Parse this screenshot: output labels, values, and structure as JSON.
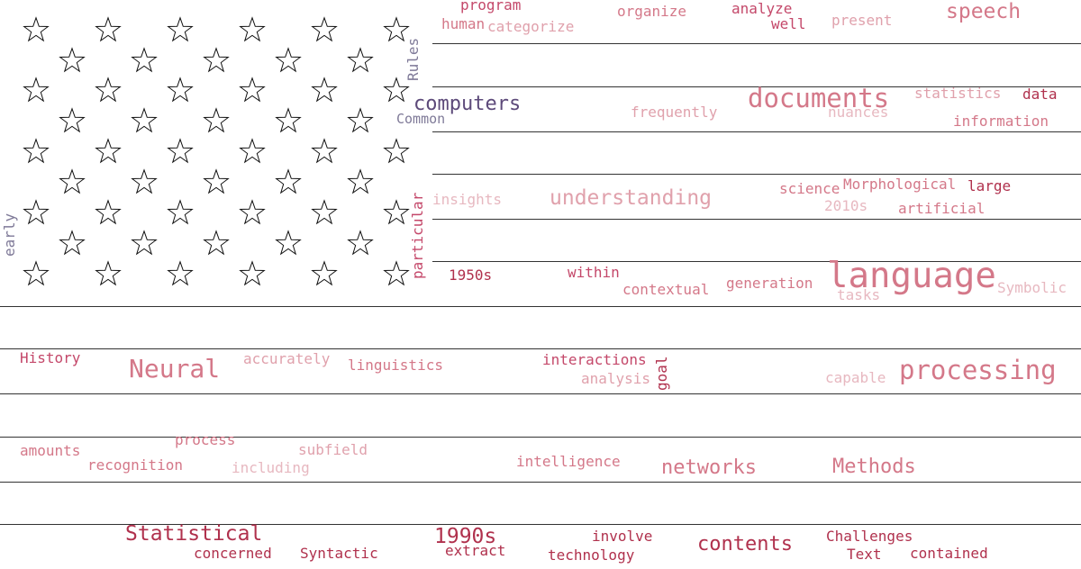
{
  "colors": {
    "dark_red": "#b0314d",
    "red": "#c4486a",
    "rose": "#d47889",
    "pink": "#e0a1ac",
    "light_pink": "#e7b8c0",
    "purple": "#5d4a7a",
    "slate": "#7f7a98"
  },
  "words": {
    "program": "program",
    "human": "human",
    "categorize": "categorize",
    "organize": "organize",
    "analyze": "analyze",
    "well": "well",
    "present": "present",
    "speech": "speech",
    "rules": "Rules",
    "computers": "computers",
    "common": "Common",
    "documents": "documents",
    "frequently": "frequently",
    "statistics": "statistics",
    "data": "data",
    "nuances": "nuances",
    "information": "information",
    "insights": "insights",
    "understanding": "understanding",
    "science": "science",
    "morphological": "Morphological",
    "large": "large",
    "year_2010s": "2010s",
    "artificial": "artificial",
    "particular": "particular",
    "early": "early",
    "year_1950s": "1950s",
    "within": "within",
    "contextual": "contextual",
    "generation": "generation",
    "language": "language",
    "tasks": "tasks",
    "symbolic": "Symbolic",
    "history": "History",
    "neural": "Neural",
    "accurately": "accurately",
    "linguistics": "linguistics",
    "interactions": "interactions",
    "analysis": "analysis",
    "goal": "goal",
    "capable": "capable",
    "processing": "processing",
    "amounts": "amounts",
    "process": "process",
    "subfield": "subfield",
    "recognition": "recognition",
    "including": "including",
    "intelligence": "intelligence",
    "networks": "networks",
    "methods": "Methods",
    "statistical": "Statistical",
    "concerned": "concerned",
    "syntactic": "Syntactic",
    "year_1990s": "1990s",
    "extract": "extract",
    "involve": "involve",
    "technology": "technology",
    "contents": "contents",
    "challenges": "Challenges",
    "text": "Text",
    "contained": "contained"
  }
}
